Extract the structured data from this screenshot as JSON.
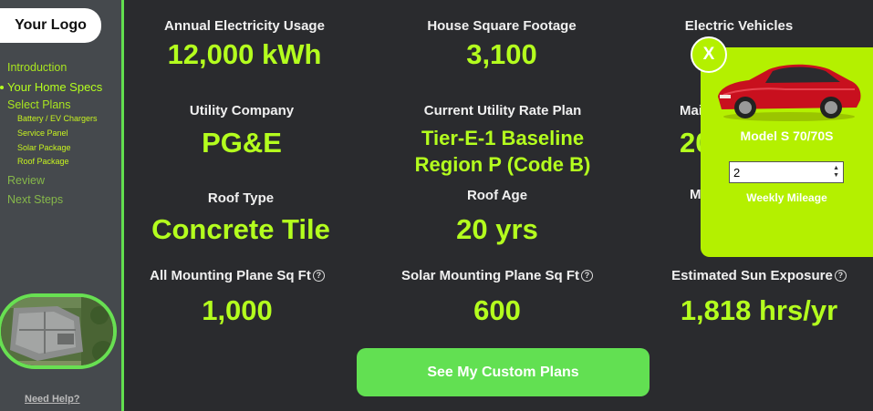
{
  "sidebar": {
    "logo": "Your Logo",
    "nav": [
      {
        "label": "Introduction"
      },
      {
        "label": "Your Home Specs"
      },
      {
        "label": "Select Plans"
      }
    ],
    "subnav": [
      "Battery / EV Chargers",
      "Service Panel",
      "Solar Package",
      "Roof Package"
    ],
    "nav_after": [
      {
        "label": "Review"
      },
      {
        "label": "Next Steps"
      }
    ],
    "need_help": "Need Help?"
  },
  "stats": {
    "electricity": {
      "label": "Annual Electricity Usage",
      "value": "12,000 kWh"
    },
    "sqft": {
      "label": "House Square Footage",
      "value": "3,100"
    },
    "ev": {
      "label": "Electric Vehicles"
    },
    "utility": {
      "label": "Utility Company",
      "value": "PG&E"
    },
    "rate_plan": {
      "label": "Current Utility Rate Plan",
      "value_line1": "Tier-E-1 Baseline",
      "value_line2": "Region P (Code B)"
    },
    "partial_label_1": "Mai",
    "partial_value_1": "20",
    "partial_label_2": "M",
    "roof_type": {
      "label": "Roof Type",
      "value": "Concrete Tile"
    },
    "roof_age": {
      "label": "Roof Age",
      "value": "20 yrs"
    },
    "all_mounting": {
      "label": "All Mounting Plane Sq Ft",
      "value": "1,000"
    },
    "solar_mounting": {
      "label": "Solar Mounting Plane Sq Ft",
      "value": "600"
    },
    "sun_exposure": {
      "label": "Estimated Sun Exposure",
      "value": "1,818 hrs/yr"
    }
  },
  "help_glyph": "?",
  "cta": "See My Custom Plans",
  "ev_popup": {
    "close": "X",
    "car_name": "Model S 70/70S",
    "mileage_value": "2",
    "mileage_label": "Weekly Mileage"
  },
  "colors": {
    "accent": "#b4ff1e",
    "popup": "#b4f000",
    "cta": "#62e052",
    "background": "#2a2b2e",
    "sidebar": "#45494d"
  }
}
